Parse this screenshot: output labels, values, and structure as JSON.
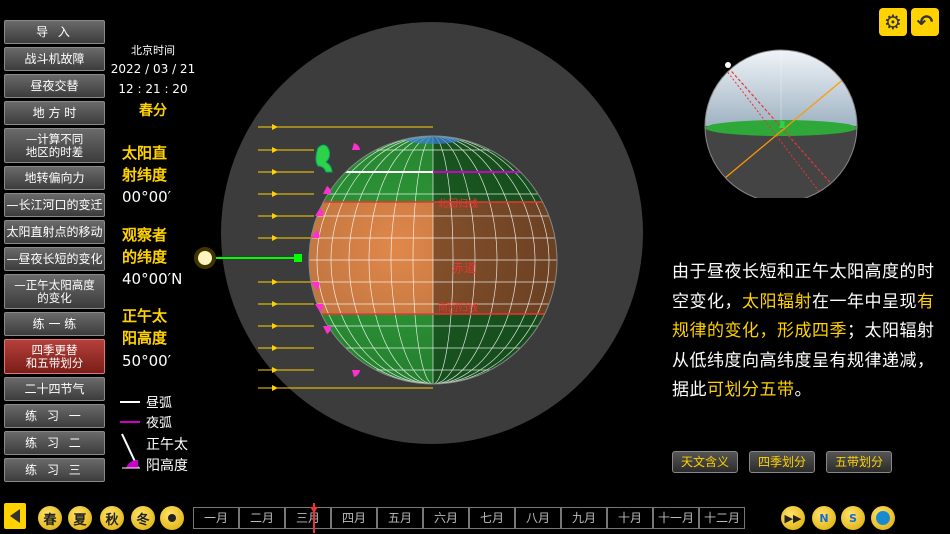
{
  "nav": [
    {
      "label": "导  入",
      "name": "nav-intro",
      "cls": "h1 sp"
    },
    {
      "label": "战斗机故障",
      "name": "nav-fighter-fault",
      "cls": "h1"
    },
    {
      "label": "昼夜交替",
      "name": "nav-day-night",
      "cls": "h1"
    },
    {
      "label": "地 方 时",
      "name": "nav-local-time",
      "cls": "h1"
    },
    {
      "label": "—计算不同\n地区的时差",
      "name": "nav-time-difference",
      "cls": "h2"
    },
    {
      "label": "地转偏向力",
      "name": "nav-coriolis",
      "cls": "h1"
    },
    {
      "label": "—长江河口的变迁",
      "name": "nav-yangtze-estuary",
      "cls": "h1"
    },
    {
      "label": "太阳直射点的移动",
      "name": "nav-subsolar-point",
      "cls": "h1"
    },
    {
      "label": "—昼夜长短的变化",
      "name": "nav-day-length",
      "cls": "h1"
    },
    {
      "label": "—正午太阳高度\n的变化",
      "name": "nav-noon-altitude",
      "cls": "h2"
    },
    {
      "label": "练 一 练",
      "name": "nav-practice",
      "cls": "h1"
    },
    {
      "label": "四季更替\n和五带划分",
      "name": "nav-seasons-zones",
      "cls": "h2 active"
    },
    {
      "label": "二十四节气",
      "name": "nav-solar-terms",
      "cls": "h1"
    },
    {
      "label": "练 习 一",
      "name": "nav-exercise-1",
      "cls": "h1 sp"
    },
    {
      "label": "练 习 二",
      "name": "nav-exercise-2",
      "cls": "h1 sp"
    },
    {
      "label": "练 习 三",
      "name": "nav-exercise-3",
      "cls": "h1 sp"
    }
  ],
  "time": {
    "label": "北京时间",
    "date": "2022 / 03 / 21",
    "clock": "12 : 21 : 20",
    "season": "春分"
  },
  "info": {
    "subsolar_label": "太阳直\n射纬度",
    "subsolar_value": "00°00′",
    "observer_label": "观察者\n的纬度",
    "observer_value": "40°00′N",
    "noon_label": "正午太\n阳高度",
    "noon_value": "50°00′"
  },
  "legend": {
    "day_arc": "昼弧",
    "night_arc": "夜弧",
    "noon_alt_1": "正午太",
    "noon_alt_2": "阳高度"
  },
  "globe_labels": {
    "tropic_cancer": "北回归线",
    "equator": "赤道",
    "tropic_capricorn": "南回归线"
  },
  "description": {
    "p1": "由于昼夜长短和正午太阳高度的时空变化，",
    "h1": "太阳辐射",
    "p2": "在一年中呈现",
    "h2": "有规律的变化，形成四季",
    "p3": "；太阳辐射从低纬度向高纬度呈有规律递减，据此",
    "h3": "可划分五带",
    "p4": "。"
  },
  "sub_buttons": [
    "天文含义",
    "四季划分",
    "五带划分"
  ],
  "seasons": [
    "春",
    "夏",
    "秋",
    "冬"
  ],
  "months": [
    "一月",
    "二月",
    "三月",
    "四月",
    "五月",
    "六月",
    "七月",
    "八月",
    "九月",
    "十月",
    "十一月",
    "十二月"
  ],
  "colors": {
    "accent": "#ffd200",
    "day_arc": "#ffffff",
    "night_arc": "#cc00cc",
    "green_zone": "#2e9e3a",
    "orange_zone": "#e0884a",
    "sun_ray": "#ffd200"
  }
}
